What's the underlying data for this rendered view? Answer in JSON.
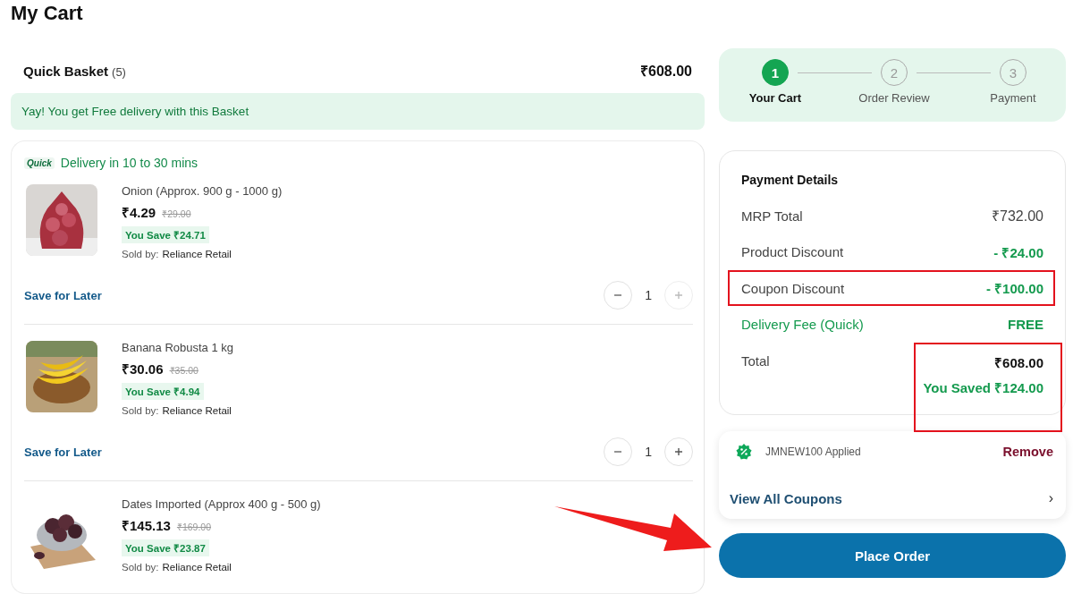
{
  "page_title": "My Cart",
  "basket": {
    "name": "Quick Basket",
    "count": "(5)",
    "total": "₹608.00",
    "banner": "Yay! You get Free delivery with this Basket",
    "delivery_badge": "Quick",
    "delivery_text": "Delivery in 10 to 30 mins",
    "items": [
      {
        "name": "Onion (Approx. 900 g - 1000 g)",
        "price": "₹4.29",
        "mrp": "₹29.00",
        "savings": "You Save ₹24.71",
        "sold_by_label": "Sold by:",
        "seller": "Reliance Retail",
        "save_later": "Save for Later",
        "quantity": "1",
        "increase_disabled": true
      },
      {
        "name": "Banana Robusta 1 kg",
        "price": "₹30.06",
        "mrp": "₹35.00",
        "savings": "You Save ₹4.94",
        "sold_by_label": "Sold by:",
        "seller": "Reliance Retail",
        "save_later": "Save for Later",
        "quantity": "1",
        "increase_disabled": false
      },
      {
        "name": "Dates Imported (Approx 400 g - 500 g)",
        "price": "₹145.13",
        "mrp": "₹169.00",
        "savings": "You Save ₹23.87",
        "sold_by_label": "Sold by:",
        "seller": "Reliance Retail"
      }
    ]
  },
  "steps": [
    {
      "number": "1",
      "label": "Your Cart",
      "selected": true
    },
    {
      "number": "2",
      "label": "Order Review",
      "selected": false
    },
    {
      "number": "3",
      "label": "Payment",
      "selected": false
    }
  ],
  "payment": {
    "title": "Payment Details",
    "rows": [
      {
        "label": "MRP Total",
        "value": "₹732.00",
        "kind": "plain",
        "highlighted": false
      },
      {
        "label": "Product Discount",
        "value": "- ₹24.00",
        "kind": "discount",
        "highlighted": false
      },
      {
        "label": "Coupon Discount",
        "value": "- ₹100.00",
        "kind": "discount",
        "highlighted": true
      },
      {
        "label": "Delivery Fee (Quick)",
        "value": "FREE",
        "kind": "free",
        "highlighted": false
      }
    ],
    "total_label": "Total",
    "total_value": "₹608.00",
    "total_saved": "You Saved ₹124.00",
    "total_highlighted": true
  },
  "coupon": {
    "applied": "JMNEW100 Applied",
    "remove": "Remove",
    "view_all": "View All Coupons",
    "chevron": "›"
  },
  "place_order": "Place Order",
  "arrow_to_place_order": true
}
